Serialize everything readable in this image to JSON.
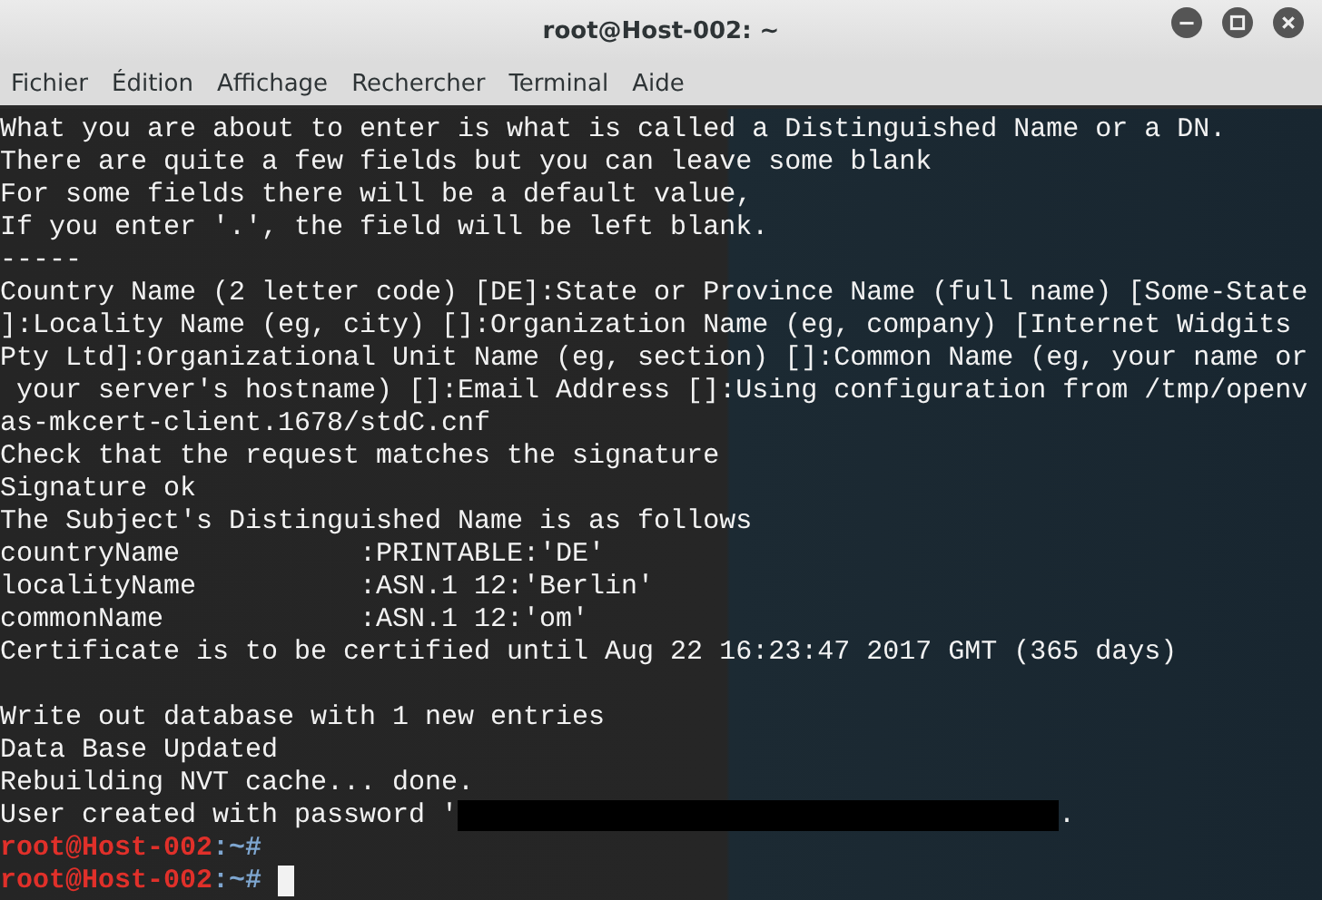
{
  "window": {
    "title": "root@Host-002: ~"
  },
  "menu": [
    {
      "label": "Fichier"
    },
    {
      "label": "Édition"
    },
    {
      "label": "Affichage"
    },
    {
      "label": "Rechercher"
    },
    {
      "label": "Terminal"
    },
    {
      "label": "Aide"
    }
  ],
  "terminal": {
    "lines": [
      {
        "kind": "text",
        "text": "What you are about to enter is what is called a Distinguished Name or a DN."
      },
      {
        "kind": "text",
        "text": "There are quite a few fields but you can leave some blank"
      },
      {
        "kind": "text",
        "text": "For some fields there will be a default value,"
      },
      {
        "kind": "text",
        "text": "If you enter '.', the field will be left blank."
      },
      {
        "kind": "text",
        "text": "-----"
      },
      {
        "kind": "text",
        "text": "Country Name (2 letter code) [DE]:State or Province Name (full name) [Some-State"
      },
      {
        "kind": "text",
        "text": "]:Locality Name (eg, city) []:Organization Name (eg, company) [Internet Widgits"
      },
      {
        "kind": "text",
        "text": "Pty Ltd]:Organizational Unit Name (eg, section) []:Common Name (eg, your name or"
      },
      {
        "kind": "text",
        "text": " your server's hostname) []:Email Address []:Using configuration from /tmp/openv"
      },
      {
        "kind": "text",
        "text": "as-mkcert-client.1678/stdC.cnf"
      },
      {
        "kind": "text",
        "text": "Check that the request matches the signature"
      },
      {
        "kind": "text",
        "text": "Signature ok"
      },
      {
        "kind": "text",
        "text": "The Subject's Distinguished Name is as follows"
      },
      {
        "kind": "text",
        "text": "countryName           :PRINTABLE:'DE'"
      },
      {
        "kind": "text",
        "text": "localityName          :ASN.1 12:'Berlin'"
      },
      {
        "kind": "text",
        "text": "commonName            :ASN.1 12:'om'"
      },
      {
        "kind": "text",
        "text": "Certificate is to be certified until Aug 22 16:23:47 2017 GMT (365 days)"
      },
      {
        "kind": "blank"
      },
      {
        "kind": "text",
        "text": "Write out database with 1 new entries"
      },
      {
        "kind": "text",
        "text": "Data Base Updated"
      },
      {
        "kind": "text",
        "text": "Rebuilding NVT cache... done."
      },
      {
        "kind": "redacted",
        "text": "User created with password '",
        "after": "."
      },
      {
        "kind": "prompt",
        "user": "root@Host-002",
        "path": ":~#",
        "cursor": false
      },
      {
        "kind": "prompt",
        "user": "root@Host-002",
        "path": ":~#",
        "cursor": true
      }
    ]
  }
}
